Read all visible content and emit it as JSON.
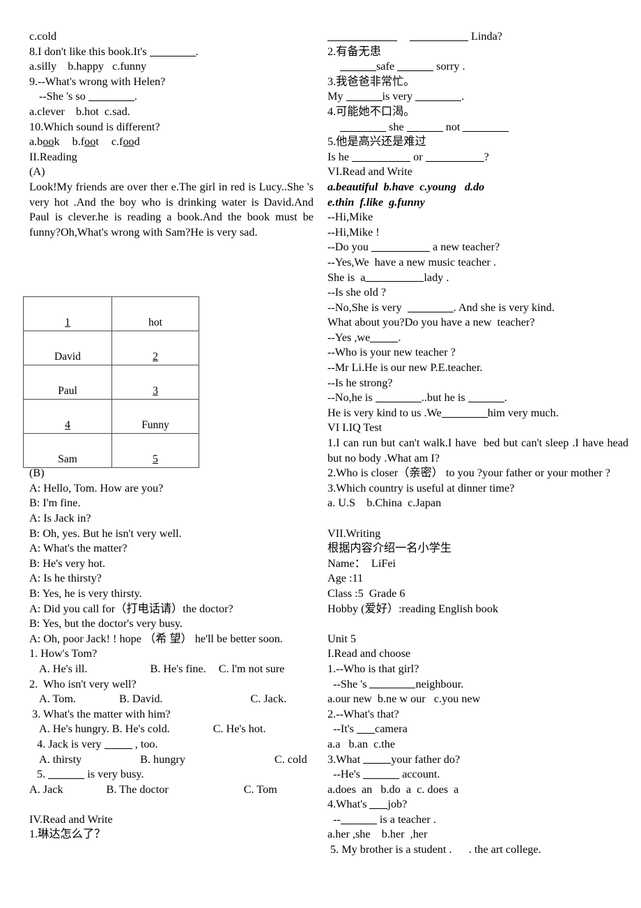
{
  "document": {
    "type": "english-exam-worksheet",
    "columns": 2
  },
  "left_column": {
    "lines": [
      "c.cold",
      "8.I don't like this book.It's ______.",
      "a.silly    b.happy   c.funny",
      "9.--What's wrong with Helen?",
      "  --She 's so ______.",
      "a.clever    b.hot  c.sad.",
      "10.Which sound is different?",
      "a.book   b.foot  c.food",
      "II.Reading",
      "(A)"
    ],
    "mc8": {
      "stem_pre": "8.I don't like this book.It's ",
      "stem_post": "."
    },
    "mc8_options": "a.silly    b.happy   c.funny",
    "q9_line1": "9.--What's wrong with Helen?",
    "q9_line2_pre": "--She 's so ",
    "q9_line2_post": ".",
    "q9_options": "a.clever    b.hot  c.sad.",
    "q10": "10.Which sound is different?",
    "q10_opt_a_pre": "a.b",
    "q10_opt_a_u": "oo",
    "q10_opt_a_post": "k",
    "q10_opt_b_pre": "b.f",
    "q10_opt_b_u": "oo",
    "q10_opt_b_post": "t",
    "q10_opt_c_pre": "c.f",
    "q10_opt_c_u": "oo",
    "q10_opt_c_post": "d",
    "section_reading": "II.Reading",
    "label_a": "(A)",
    "passage": "Look!My friends are over ther e.The girl in red is Lucy..She 's very hot .And the boy who is drinking water is David.And Paul is clever.he is reading a book.And the book must be funny?Oh,What's wrong with Sam?He is very sad.",
    "table": {
      "rows": [
        {
          "left": "1",
          "left_blank": true,
          "right": "hot",
          "right_blank": false
        },
        {
          "left": "David",
          "left_blank": false,
          "right": "2",
          "right_blank": true
        },
        {
          "left": "Paul",
          "left_blank": false,
          "right": "3",
          "right_blank": true
        },
        {
          "left": "4",
          "left_blank": true,
          "right": "Funny",
          "right_blank": false
        },
        {
          "left": "Sam",
          "left_blank": false,
          "right": "5",
          "right_blank": true
        }
      ]
    },
    "label_b": "(B)",
    "dialogue": [
      "A: Hello, Tom. How are you?",
      "B: I'm fine.",
      "A: Is Jack in?",
      "B: Oh, yes. But he isn't very well.",
      "A: What's the matter?",
      "B: He's very hot.",
      "A: Is he thirsty?",
      "B: Yes, he is very thirsty.",
      "A: Did you call for（打电话请）the doctor?",
      "B: Yes, but the doctor's very busy."
    ],
    "dialogue_last": "A: Oh, poor Jack! ! hope （希 望） he'll be better soon.",
    "questions": [
      {
        "stem": "1. How's Tom?",
        "options": [
          "A. He's ill.",
          "B. He's fine.",
          "C. l'm not sure"
        ]
      },
      {
        "stem": "2.  Who isn't very well?",
        "options": [
          "A. Tom.",
          "B. David.",
          "C. Jack."
        ]
      },
      {
        "stem": " 3. What's the matter with him?",
        "options": [
          "A. He's hungry.",
          "B. He's cold.",
          "C. He's hot."
        ]
      },
      {
        "stem": " 4. Jack is very ___ , too.",
        "options": [
          "A. thirsty",
          "B. hungry",
          "C. cold"
        ]
      },
      {
        "stem": " 5. _____ is very busy.",
        "options": [
          "A. Jack",
          "B. The doctor",
          "C. Tom"
        ]
      }
    ],
    "q4_stem_pre": " 4. Jack is very ",
    "q4_stem_post": " , too.",
    "q5_stem_pre": " 5. ",
    "q5_stem_post": " is very busy.",
    "section_iv": "IV.Read and Write",
    "iv_item1": "1.琳达怎么了？"
  },
  "right_column": {
    "trans_1_answer_post": "Linda?",
    "trans_2_cn": "2.有备无患",
    "trans_2_mid": "safe",
    "trans_2_post": "sorry .",
    "trans_3_cn": "3.我爸爸非常忙。",
    "trans_3_pre": "My ",
    "trans_3_mid": "is very ",
    "trans_3_post": ".",
    "trans_4_cn": "4.可能她不口渴。",
    "trans_4_mid": "she ",
    "trans_4_post": "not ",
    "trans_5_cn": "5.他是高兴还是难过",
    "trans_5_pre": "Is he ",
    "trans_5_mid": "or ",
    "trans_5_post": "?",
    "section_vi": "VI.Read and Write",
    "wordbank_line1": "a.beautiful  b.have  c.young   d.do",
    "wordbank_line2": "e.thin  f.like  g.funny",
    "dialogue": [
      "--Hi,Mike",
      "--Hi,Mike !",
      "--Do you ________ a new teacher?",
      "--Yes,We  have a new music teacher .",
      "She is  a__________lady .",
      "--Is she old ?",
      "--No,She is very  ________. And she is very kind.",
      "What about you?Do you have a new  teacher?",
      "--Yes ,we_____.",
      "--Who is your new teacher ?",
      "--Mr Li.He is our new P.E.teacher.",
      "--Is he strong?",
      "--No,he is ________..but he is ______.",
      "He is very kind to us .We________him very much."
    ],
    "d_line3_pre": "--Do you ",
    "d_line3_post": " a new teacher?",
    "d_line4": "--Yes,We  have a new music teacher .",
    "d_line5_pre": "She is  a",
    "d_line5_post": "lady .",
    "d_line6": "--Is she old ?",
    "d_line7_pre": "--No,She is very  ",
    "d_line7_post": ". And she is very kind.",
    "d_line8": "What about you?Do you have a new  teacher?",
    "d_line9_pre": "--Yes ,we",
    "d_line9_post": ".",
    "d_line10": "--Who is your new teacher ?",
    "d_line11": "--Mr Li.He is our new P.E.teacher.",
    "d_line12": "--Is he strong?",
    "d_line13_pre": "--No,he is ",
    "d_line13_mid": "..but he is ",
    "d_line13_post": ".",
    "d_line14_pre": "He is very kind to us .We",
    "d_line14_post": "him very much.",
    "section_vii_iq": "VI I.IQ Test",
    "iq_1": "1.I can run but can't walk.I have  bed but can't sleep .I have head but no body .What am I?",
    "iq_2": "2.Who is closer（亲密） to you ?your father or your mother ?",
    "iq_3": "3.Which country is useful at dinner time?",
    "iq_3_options": "a. U.S    b.China  c.Japan",
    "section_writing": "VII.Writing",
    "writing_prompt": "根据内容介绍一名小学生",
    "writing_fields": [
      "Name：  LiFei",
      "Age :11",
      "Class :5  Grade 6",
      "Hobby (爱好）:reading English book"
    ],
    "unit_heading": "Unit 5",
    "section_i": "I.Read and choose",
    "u5_q1_line1": "1.--Who is that girl?",
    "u5_q1_line2_pre": "  --She 's ",
    "u5_q1_line2_post": "neighbour.",
    "u5_q1_options": "a.our new  b.ne w our   c.you new",
    "u5_q2_line1": "2.--What's that?",
    "u5_q2_line2_pre": "  --It's ",
    "u5_q2_line2_post": "camera",
    "u5_q2_options": "a.a   b.an  c.the",
    "u5_q3_line1_pre": "3.What ",
    "u5_q3_line1_post": "your father do?",
    "u5_q3_line2_pre": "  --He's ",
    "u5_q3_line2_post": " account.",
    "u5_q3_options": "a.does  an   b.do  a  c. does  a",
    "u5_q4_line1_pre": "4.What's ",
    "u5_q4_line1_post": "job?",
    "u5_q4_line2_pre": "  --",
    "u5_q4_line2_post": " is a teacher .",
    "u5_q4_options": "a.her ,she    b.her  ,her",
    "u5_q5": " 5. My brother is a student .      . the art college."
  }
}
